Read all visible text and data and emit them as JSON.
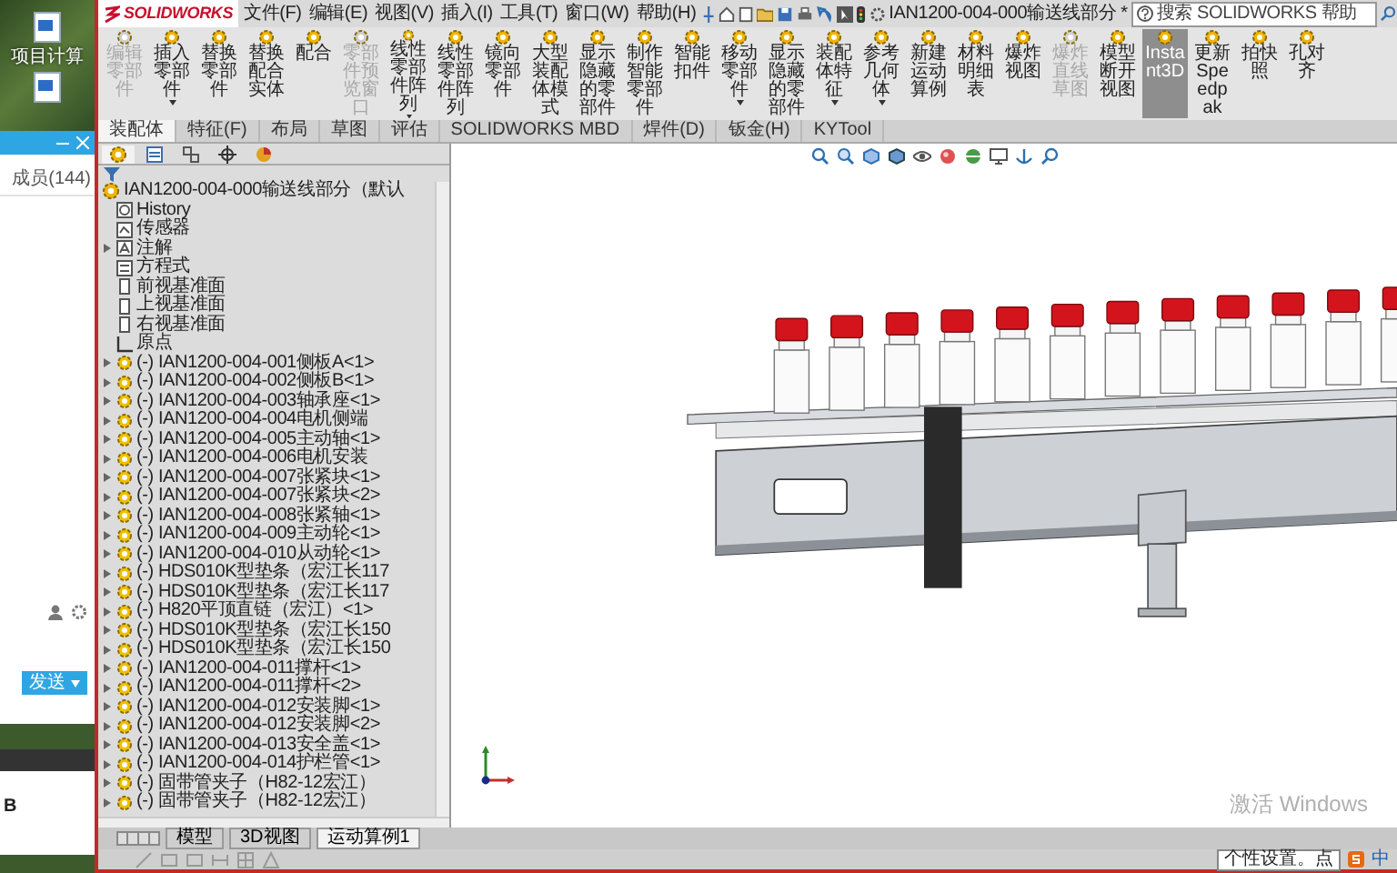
{
  "desktop": {
    "icon_label": "项目计算"
  },
  "chat": {
    "members": "成员(144)",
    "send_button": "发送"
  },
  "lower_window": {
    "text": "B"
  },
  "app": {
    "logo": "SOLIDWORKS",
    "menus": [
      "文件(F)",
      "编辑(E)",
      "视图(V)",
      "插入(I)",
      "工具(T)",
      "窗口(W)",
      "帮助(H)"
    ],
    "title": "IAN1200-004-000输送线部分 *",
    "search": {
      "placeholder": "搜索 SOLIDWORKS 帮助"
    }
  },
  "ribbon": [
    {
      "label": "编辑零部件",
      "disabled": true,
      "selected": false,
      "dropdown": false
    },
    {
      "label": "插入零部件",
      "disabled": false,
      "selected": false,
      "dropdown": true
    },
    {
      "label": "替换零部件",
      "disabled": false,
      "selected": false,
      "dropdown": false
    },
    {
      "label": "替换配合实体",
      "disabled": false,
      "selected": false,
      "dropdown": false
    },
    {
      "label": "配合",
      "disabled": false,
      "selected": false,
      "dropdown": false
    },
    {
      "label": "零部件预览窗口",
      "disabled": true,
      "selected": false,
      "dropdown": false
    },
    {
      "label": "线性零部件阵列",
      "disabled": false,
      "selected": false,
      "dropdown": true
    },
    {
      "label": "线性零部件阵列",
      "disabled": false,
      "selected": false,
      "dropdown": false
    },
    {
      "label": "镜向零部件",
      "disabled": false,
      "selected": false,
      "dropdown": false
    },
    {
      "label": "大型装配体模式",
      "disabled": false,
      "selected": false,
      "dropdown": false
    },
    {
      "label": "显示隐藏的零部件",
      "disabled": false,
      "selected": false,
      "dropdown": false
    },
    {
      "label": "制作智能零部件",
      "disabled": false,
      "selected": false,
      "dropdown": false
    },
    {
      "label": "智能扣件",
      "disabled": false,
      "selected": false,
      "dropdown": false
    },
    {
      "label": "移动零部件",
      "disabled": false,
      "selected": false,
      "dropdown": true
    },
    {
      "label": "显示隐藏的零部件",
      "disabled": false,
      "selected": false,
      "dropdown": false
    },
    {
      "label": "装配体特征",
      "disabled": false,
      "selected": false,
      "dropdown": true
    },
    {
      "label": "参考几何体",
      "disabled": false,
      "selected": false,
      "dropdown": true
    },
    {
      "label": "新建运动算例",
      "disabled": false,
      "selected": false,
      "dropdown": false
    },
    {
      "label": "材料明细表",
      "disabled": false,
      "selected": false,
      "dropdown": false
    },
    {
      "label": "爆炸视图",
      "disabled": false,
      "selected": false,
      "dropdown": false
    },
    {
      "label": "爆炸直线草图",
      "disabled": true,
      "selected": false,
      "dropdown": false
    },
    {
      "label": "模型断开视图",
      "disabled": false,
      "selected": false,
      "dropdown": false
    },
    {
      "label": "Instant3D",
      "disabled": false,
      "selected": true,
      "dropdown": false
    },
    {
      "label": "更新Speedpak",
      "disabled": false,
      "selected": false,
      "dropdown": false
    },
    {
      "label": "拍快照",
      "disabled": false,
      "selected": false,
      "dropdown": false
    },
    {
      "label": "孔对齐",
      "disabled": false,
      "selected": false,
      "dropdown": false
    }
  ],
  "command_tabs": [
    {
      "label": "装配体",
      "selected": true
    },
    {
      "label": "特征(F)",
      "selected": false
    },
    {
      "label": "布局",
      "selected": false
    },
    {
      "label": "草图",
      "selected": false
    },
    {
      "label": "评估",
      "selected": false
    },
    {
      "label": "SOLIDWORKS MBD",
      "selected": false
    },
    {
      "label": "焊件(D)",
      "selected": false
    },
    {
      "label": "钣金(H)",
      "selected": false
    },
    {
      "label": "KYTool",
      "selected": false
    }
  ],
  "tree": {
    "tabs": [
      {
        "selected": true
      },
      {
        "selected": false
      },
      {
        "selected": false
      },
      {
        "selected": false
      },
      {
        "selected": false
      }
    ],
    "items": [
      {
        "kind": "root",
        "label": "IAN1200-004-000输送线部分（默认",
        "expandable": false
      },
      {
        "kind": "history",
        "label": "History",
        "expandable": false
      },
      {
        "kind": "sensor",
        "label": "传感器",
        "expandable": false
      },
      {
        "kind": "note",
        "label": "注解",
        "expandable": true
      },
      {
        "kind": "equation",
        "label": "方程式",
        "expandable": false
      },
      {
        "kind": "plane",
        "label": "前视基准面",
        "expandable": false
      },
      {
        "kind": "plane",
        "label": "上视基准面",
        "expandable": false
      },
      {
        "kind": "plane",
        "label": "右视基准面",
        "expandable": false
      },
      {
        "kind": "origin",
        "label": "原点",
        "expandable": false
      },
      {
        "kind": "part",
        "label": "(-) IAN1200-004-001侧板A<1>",
        "expandable": true
      },
      {
        "kind": "part",
        "label": "(-) IAN1200-004-002侧板B<1>",
        "expandable": true
      },
      {
        "kind": "part",
        "label": "(-) IAN1200-004-003轴承座<1>",
        "expandable": true
      },
      {
        "kind": "part",
        "label": "(-) IAN1200-004-004电机侧端",
        "expandable": true
      },
      {
        "kind": "part",
        "label": "(-) IAN1200-004-005主动轴<1>",
        "expandable": true
      },
      {
        "kind": "part",
        "label": "(-) IAN1200-004-006电机安装",
        "expandable": true
      },
      {
        "kind": "part",
        "label": "(-) IAN1200-004-007张紧块<1>",
        "expandable": true
      },
      {
        "kind": "part",
        "label": "(-) IAN1200-004-007张紧块<2>",
        "expandable": true
      },
      {
        "kind": "part",
        "label": "(-) IAN1200-004-008张紧轴<1>",
        "expandable": true
      },
      {
        "kind": "part",
        "label": "(-) IAN1200-004-009主动轮<1>",
        "expandable": true
      },
      {
        "kind": "part",
        "label": "(-) IAN1200-004-010从动轮<1>",
        "expandable": true
      },
      {
        "kind": "part",
        "label": "(-) HDS010K型垫条（宏江长117",
        "expandable": true
      },
      {
        "kind": "part",
        "label": "(-) HDS010K型垫条（宏江长117",
        "expandable": true
      },
      {
        "kind": "part",
        "label": "(-) H820平顶直链（宏江）<1>",
        "expandable": true
      },
      {
        "kind": "part",
        "label": "(-) HDS010K型垫条（宏江长150",
        "expandable": true
      },
      {
        "kind": "part",
        "label": "(-) HDS010K型垫条（宏江长150",
        "expandable": true
      },
      {
        "kind": "part",
        "label": "(-) IAN1200-004-011撑杆<1>",
        "expandable": true
      },
      {
        "kind": "part",
        "label": "(-) IAN1200-004-011撑杆<2>",
        "expandable": true
      },
      {
        "kind": "part",
        "label": "(-) IAN1200-004-012安装脚<1>",
        "expandable": true
      },
      {
        "kind": "part",
        "label": "(-) IAN1200-004-012安装脚<2>",
        "expandable": true
      },
      {
        "kind": "part",
        "label": "(-) IAN1200-004-013安全盖<1>",
        "expandable": true
      },
      {
        "kind": "part",
        "label": "(-) IAN1200-004-014护栏管<1>",
        "expandable": true
      },
      {
        "kind": "part",
        "label": "(-) 固带管夹子（H82-12宏江）",
        "expandable": true
      },
      {
        "kind": "part",
        "label": "(-) 固带管夹子（H82-12宏江）",
        "expandable": true
      }
    ]
  },
  "bottom_tabs": [
    {
      "label": "模型",
      "selected": false
    },
    {
      "label": "3D视图",
      "selected": false
    },
    {
      "label": "运动算例1",
      "selected": true
    }
  ],
  "activation_notice": "激活 Windows",
  "tooltip": "个性设置。点",
  "ime": "中"
}
